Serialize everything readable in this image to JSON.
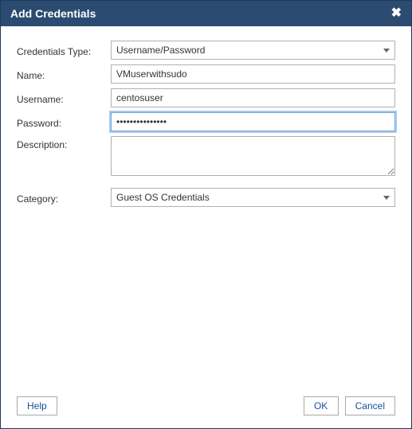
{
  "titlebar": {
    "title": "Add Credentials"
  },
  "form": {
    "credentials_type": {
      "label": "Credentials Type:",
      "value": "Username/Password"
    },
    "name": {
      "label": "Name:",
      "value": "VMuserwithsudo"
    },
    "username": {
      "label": "Username:",
      "value": "centosuser"
    },
    "password": {
      "label": "Password:",
      "value": "•••••••••••••••"
    },
    "description": {
      "label": "Description:",
      "value": ""
    },
    "category": {
      "label": "Category:",
      "value": "Guest OS Credentials"
    }
  },
  "buttons": {
    "help": "Help",
    "ok": "OK",
    "cancel": "Cancel"
  }
}
